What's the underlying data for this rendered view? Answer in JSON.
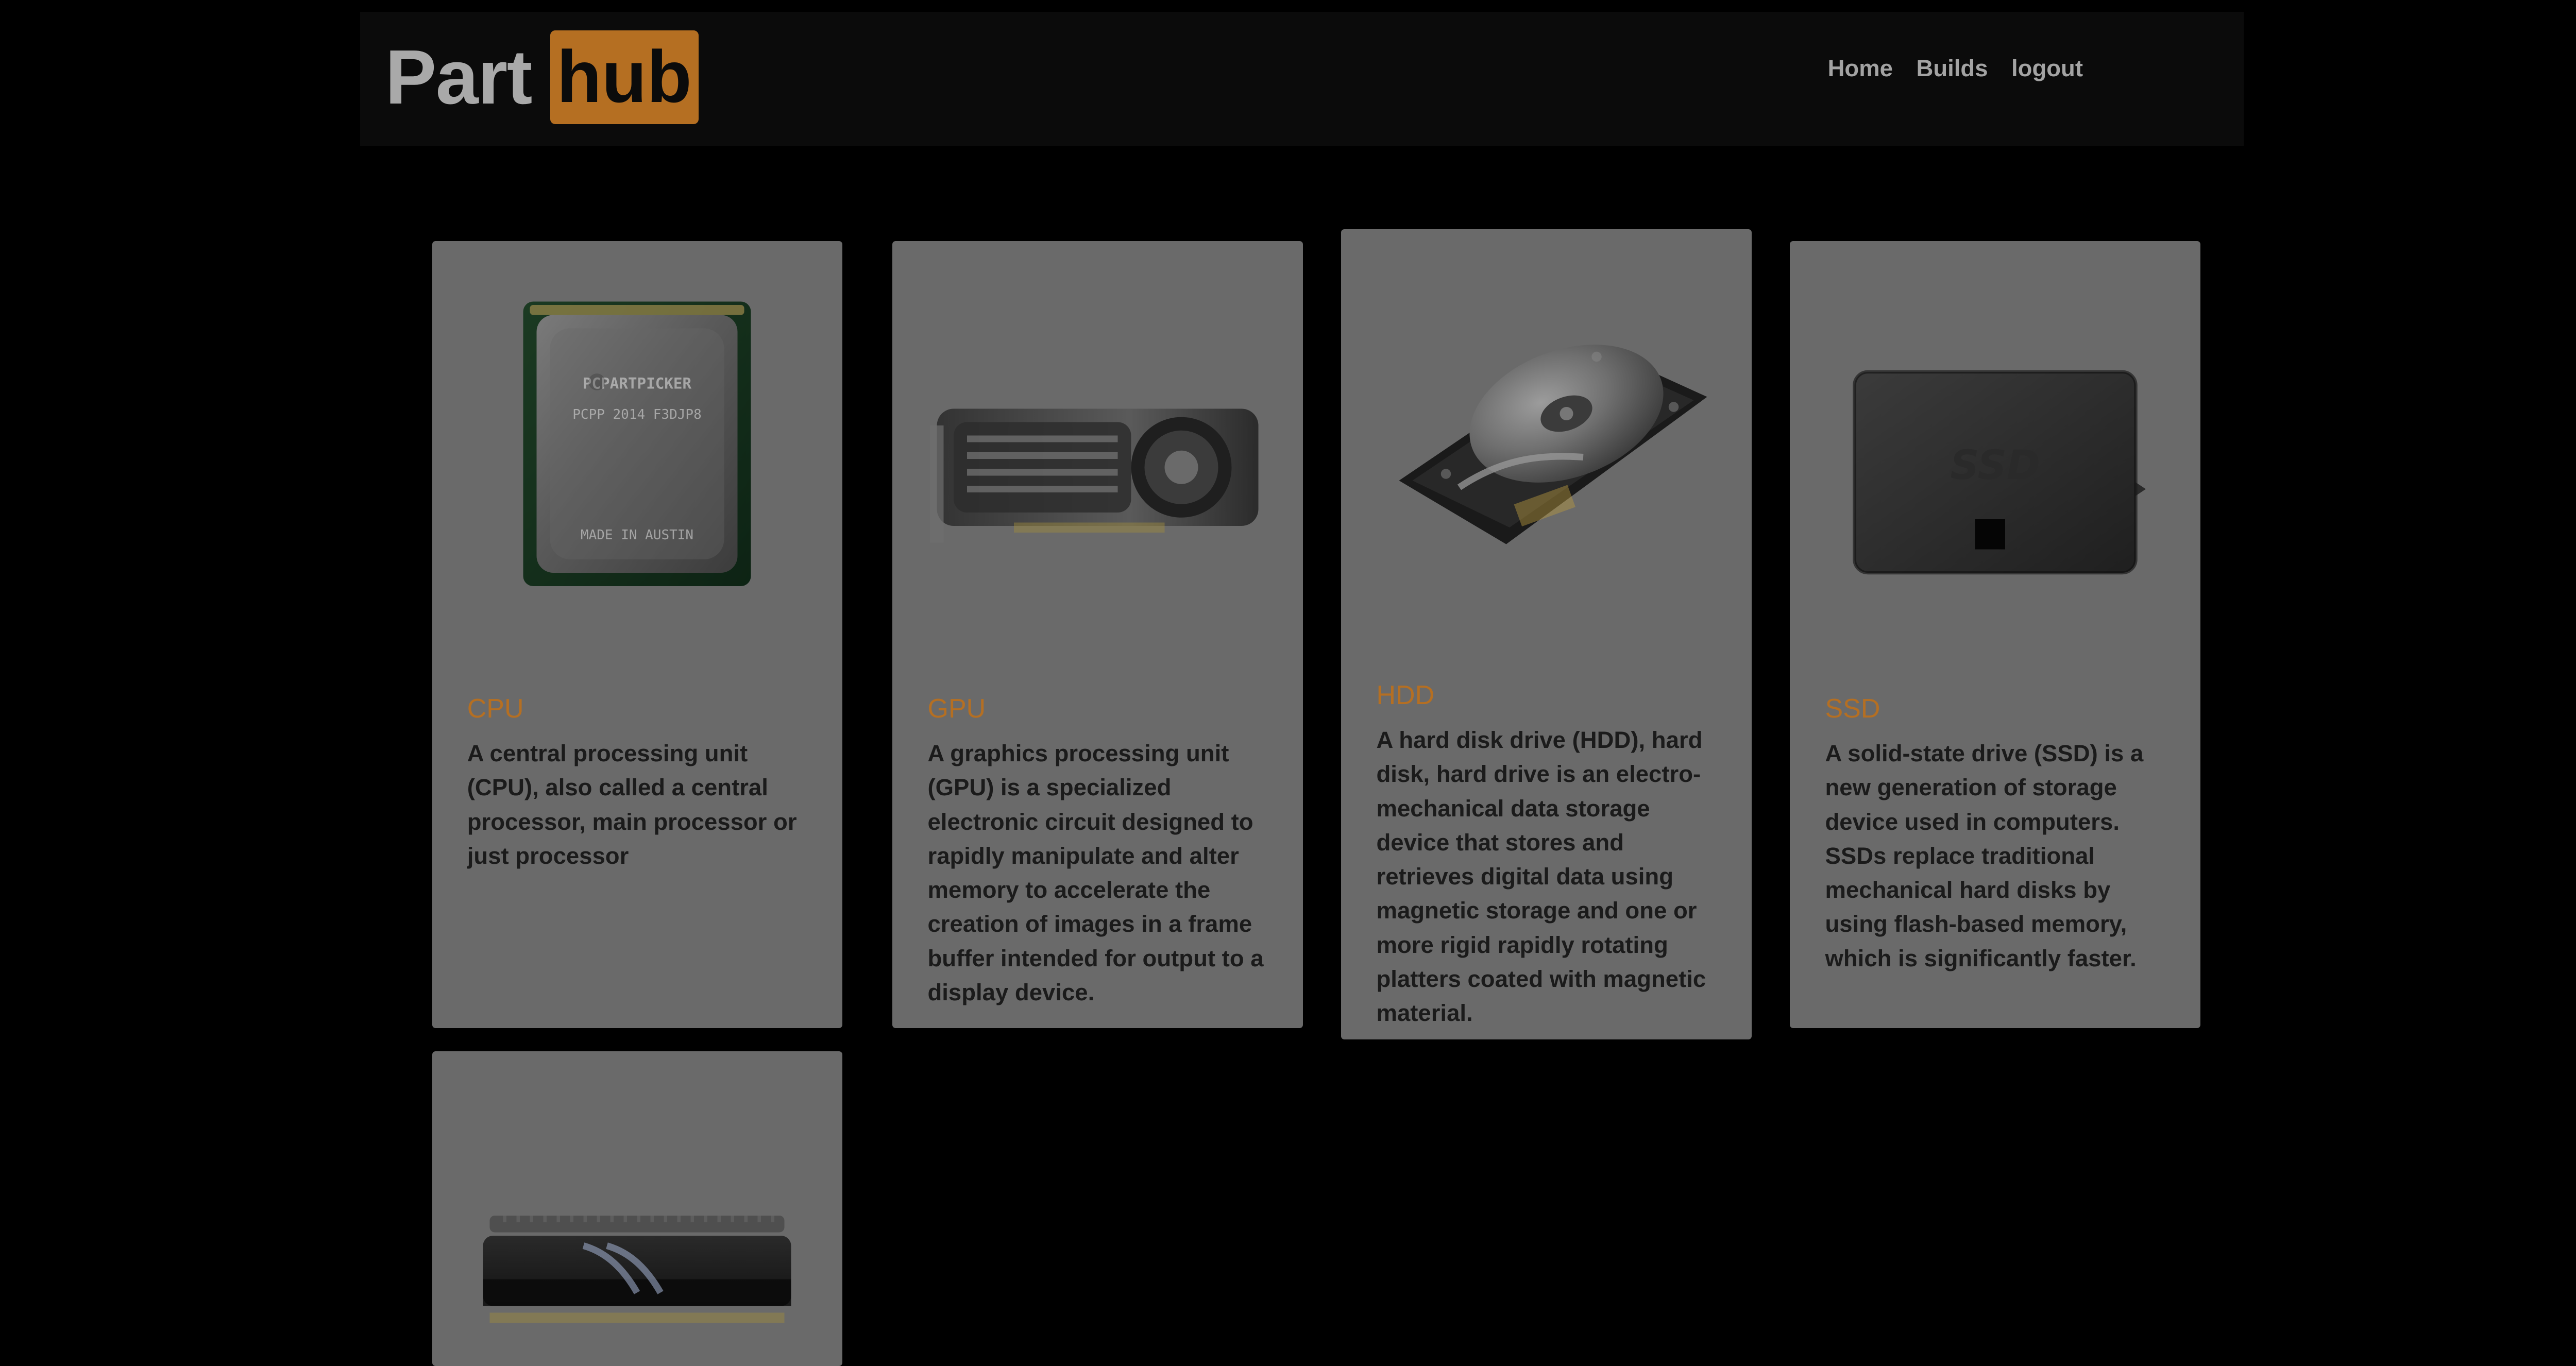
{
  "colors": {
    "accent": "#b56f22"
  },
  "header": {
    "brand": {
      "part": "Part",
      "hub": "hub"
    },
    "nav": {
      "items": [
        {
          "label": "Home"
        },
        {
          "label": "Builds"
        },
        {
          "label": "logout"
        }
      ]
    }
  },
  "cards": [
    {
      "title": "CPU",
      "description": "A central processing unit (CPU), also called a central processor, main processor or just processor",
      "image": {
        "icon": "cpu-icon",
        "lines": [
          "PCPARTPICKER",
          "PCPP 2014 F3DJP8",
          "MADE IN AUSTIN"
        ]
      }
    },
    {
      "title": "GPU",
      "description": "A graphics processing unit (GPU) is a specialized electronic circuit designed to rapidly manipulate and alter memory to accelerate the creation of images in a frame buffer intended for output to a display device.",
      "image": {
        "icon": "gpu-icon"
      }
    },
    {
      "title": "HDD",
      "description": "A hard disk drive (HDD), hard disk, hard drive is an electro-mechanical data storage device that stores and retrieves digital data using magnetic storage and one or more rigid rapidly rotating platters coated with magnetic material.",
      "image": {
        "icon": "hdd-icon"
      }
    },
    {
      "title": "SSD",
      "description": "A solid-state drive (SSD) is a new generation of storage device used in computers. SSDs replace traditional mechanical hard disks by using flash-based memory, which is significantly faster.",
      "image": {
        "icon": "ssd-icon",
        "label": "SSD"
      }
    },
    {
      "image": {
        "icon": "ram-icon"
      }
    }
  ]
}
